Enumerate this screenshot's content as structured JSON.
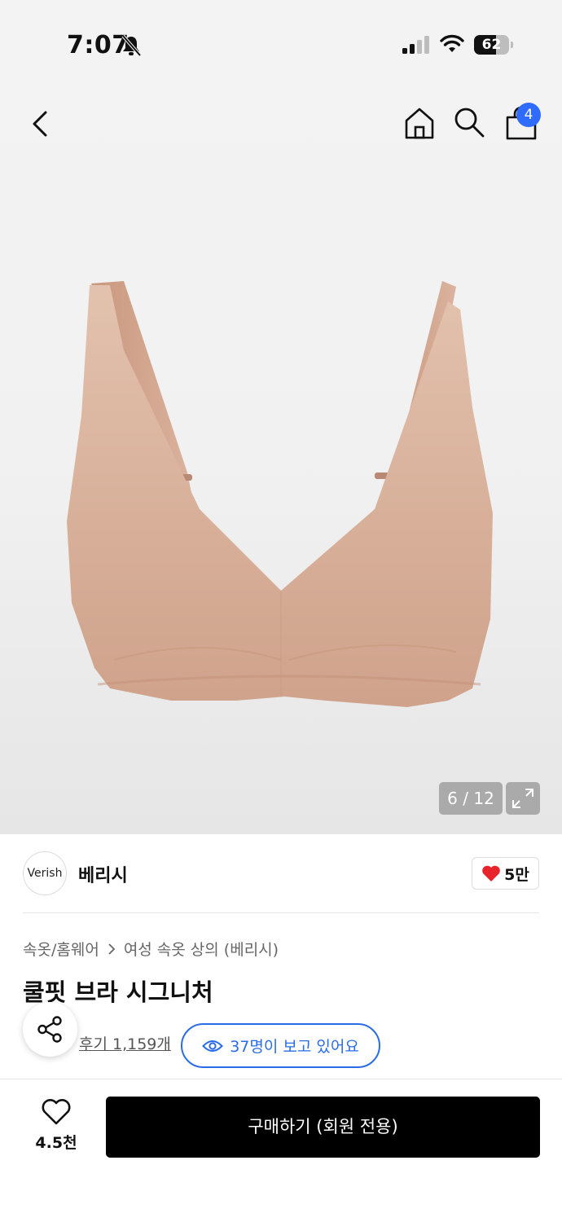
{
  "status_bar": {
    "time": "7:07",
    "battery_level": "62"
  },
  "nav": {
    "cart_count": "4"
  },
  "gallery": {
    "page_indicator": "6 / 12"
  },
  "brand": {
    "logo_text": "Verish",
    "name": "베리시",
    "likes": "5만"
  },
  "product": {
    "breadcrumb": [
      "속옷/홈웨어",
      "여성 속옷 상의 (베리시)"
    ],
    "title": "쿨핏 브라 시그니처",
    "reviews": "후기 1,159개",
    "viewers": "37명이 보고 있어요"
  },
  "bottom_bar": {
    "wishlist_count": "4.5천",
    "buy_label": "구매하기 (회원 전용)"
  },
  "colors": {
    "accent_blue": "#2a6ce6",
    "badge_blue": "#2f6bff",
    "heart_red": "#e8232a",
    "buy_button": "#000000"
  }
}
